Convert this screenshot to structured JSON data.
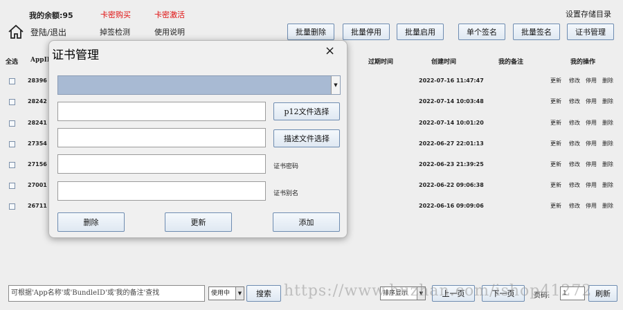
{
  "header": {
    "balance": "我的余额:95",
    "buy_card": "卡密购买",
    "activate_card": "卡密激活",
    "settings_dir": "设置存储目录",
    "login_logout": "登陆/退出",
    "sign_check": "掉签检测",
    "usage_help": "使用说明"
  },
  "toolbar": {
    "batch_delete": "批量删除",
    "batch_disable": "批量停用",
    "batch_enable": "批量启用",
    "single_sign": "单个签名",
    "batch_sign": "批量签名",
    "cert_manage": "证书管理"
  },
  "table": {
    "headers": {
      "select_all": "全选",
      "appid": "AppID",
      "expire": "过期时间",
      "created": "创建时间",
      "notes": "我的备注",
      "actions": "我的操作"
    },
    "rows": [
      {
        "id": "28396",
        "created": "2022-07-16 11:47:47"
      },
      {
        "id": "28242",
        "created": "2022-07-14 10:03:48"
      },
      {
        "id": "28241",
        "created": "2022-07-14 10:01:20"
      },
      {
        "id": "27354",
        "created": "2022-06-27 22:01:13"
      },
      {
        "id": "27156",
        "created": "2022-06-23 21:39:25"
      },
      {
        "id": "27001",
        "created": "2022-06-22 09:06:38"
      },
      {
        "id": "26711",
        "created": "2022-06-16 09:09:06"
      }
    ],
    "ops": {
      "update": "更新",
      "edit": "修改",
      "disable": "停用",
      "delete": "删除"
    }
  },
  "dialog": {
    "title": "证书管理",
    "close": "×",
    "p12_button": "p12文件选择",
    "profile_button": "描述文件选择",
    "password_label": "证书密码",
    "alias_label": "证书别名",
    "delete_button": "删除",
    "update_button": "更新",
    "add_button": "添加"
  },
  "bottom": {
    "search_placeholder": "可根据'App名称'或'BundleID'或'我的备注'查找",
    "status_select": "使用中",
    "search_button": "搜索",
    "sort_select": "排序显示",
    "prev_page": "上一页",
    "next_page": "下一页",
    "page_label": "页码:",
    "page_number": "1",
    "refresh": "刷新"
  },
  "watermark": "https://www.huzhan.com/ishop41272",
  "colors": {
    "accent_red": "#e01010",
    "combo_blue": "#a8bad3"
  }
}
